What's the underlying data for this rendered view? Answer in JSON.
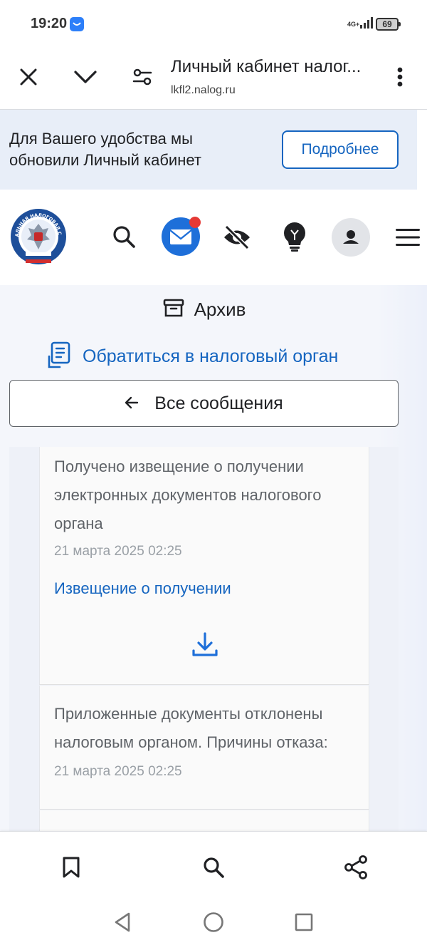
{
  "status_bar": {
    "time": "19:20",
    "network": "4G+",
    "battery": "69"
  },
  "browser_toolbar": {
    "page_title": "Личный кабинет налог...",
    "url": "lkfl2.nalog.ru"
  },
  "banner": {
    "text": "Для Вашего удобства мы обновили Личный кабинет",
    "button_label": "Подробнее"
  },
  "site_header": {
    "logo_text": "ФЕДЕРАЛЬНАЯ НАЛОГОВАЯ СЛУЖБА"
  },
  "archive": {
    "label": "Архив"
  },
  "contact_link": {
    "label": "Обратиться в налоговый орган"
  },
  "all_messages": {
    "label": "Все сообщения"
  },
  "messages": [
    {
      "text": "Получено извещение о получении электронных документов налогового органа",
      "date": "21 марта 2025 02:25",
      "link": "Извещение о получении"
    },
    {
      "text": "Приложенные документы отклонены налоговым органом. Причины отказа:",
      "date": "21 марта 2025 02:25"
    }
  ],
  "colors": {
    "accent": "#1565c0",
    "icon_blue": "#1e6fd9",
    "badge_red": "#e53935",
    "banner_bg": "#e8eef8",
    "page_bg": "#f4f6fb"
  }
}
